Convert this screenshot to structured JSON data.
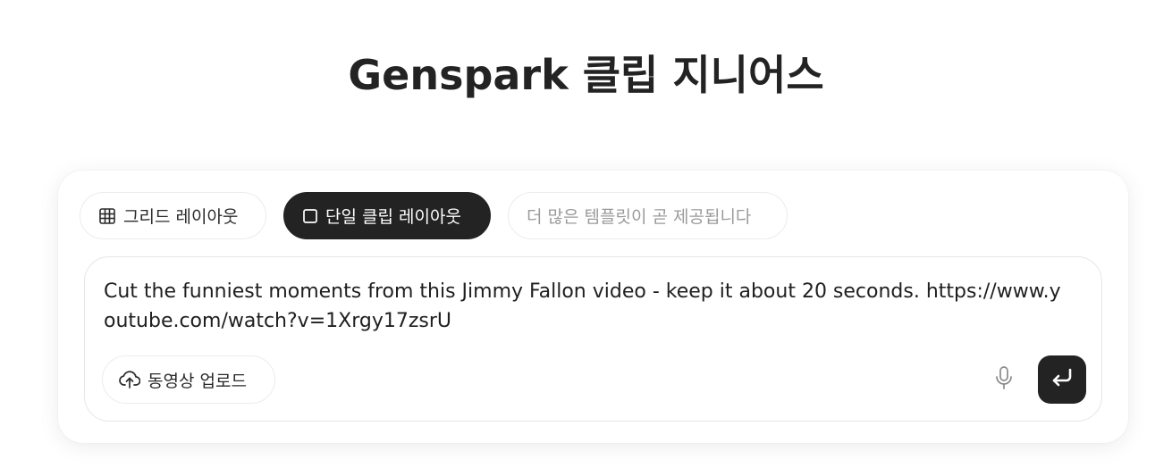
{
  "page": {
    "title": "Genspark 클립 지니어스"
  },
  "tabs": [
    {
      "label": "그리드 레이아웃",
      "icon": "grid-icon",
      "active": false
    },
    {
      "label": "단일 클립 레이아웃",
      "icon": "square-icon",
      "active": true
    },
    {
      "label": "더 많은 템플릿이 곧 제공됩니다",
      "active": false,
      "disabled": true
    }
  ],
  "prompt": {
    "value": "Cut the funniest moments from this Jimmy Fallon video - keep it about 20 seconds. https://www.youtube.com/watch?v=1Xrgy17zsrU"
  },
  "toolbar": {
    "upload_label": "동영상 업로드",
    "upload_icon": "cloud-upload-icon",
    "mic_icon": "microphone-icon",
    "send_icon": "enter-arrow-icon"
  },
  "colors": {
    "accent_dark": "#232323",
    "muted_text": "#9a9a9a",
    "border": "#ececec"
  }
}
